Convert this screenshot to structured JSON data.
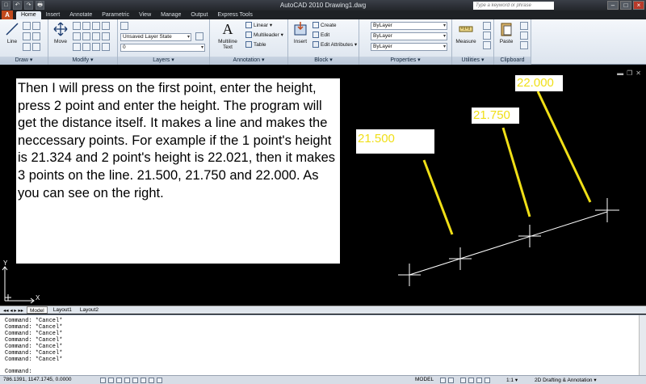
{
  "titlebar": {
    "title": "AutoCAD 2010     Drawing1.dwg",
    "search_placeholder": "Type a keyword or phrase",
    "qat": [
      "□",
      "↶",
      "↷",
      "🖶"
    ]
  },
  "tabs": [
    "Home",
    "Insert",
    "Annotate",
    "Parametric",
    "View",
    "Manage",
    "Output",
    "Express Tools"
  ],
  "ribbon": {
    "draw": {
      "title": "Draw ▾",
      "line_label": "Line"
    },
    "modify": {
      "title": "Modify ▾",
      "move_label": "Move"
    },
    "layers": {
      "title": "Layers ▾",
      "layer_state": "Unsaved Layer State",
      "current_layer": "0"
    },
    "annotation": {
      "title": "Annotation ▾",
      "multiline_text": "Multiline\nText",
      "linear": "Linear ▾",
      "multileader": "Multileader ▾",
      "table": "Table"
    },
    "block": {
      "title": "Block ▾",
      "insert": "Insert",
      "create": "Create",
      "edit": "Edit",
      "edit_attributes": "Edit Attributes ▾"
    },
    "properties": {
      "title": "Properties ▾",
      "color": "ByLayer",
      "linetype": "ByLayer",
      "lineweight": "ByLayer"
    },
    "utilities": {
      "title": "Utilities ▾",
      "measure": "Measure"
    },
    "clipboard": {
      "title": "Clipboard",
      "paste": "Paste"
    }
  },
  "note": "Then I will press on the first point, enter the height, press 2 point and enter the height. The program will get the distance itself. It makes a line and makes the neccessary points. For example if the 1 point's height is 21.324 and 2 point's height is 22.021, then it makes 3 points on the line.  21.500, 21.750 and 22.000. As you can see on the right.",
  "labels": [
    "21.500",
    "21.750",
    "22.000"
  ],
  "ucs": {
    "y": "Y",
    "x": "X"
  },
  "layout_tabs": [
    "Model",
    "Layout1",
    "Layout2"
  ],
  "command": {
    "history": [
      "Command: *Cancel*",
      "Command: *Cancel*",
      "Command: *Cancel*",
      "Command: *Cancel*",
      "Command: *Cancel*",
      "Command: *Cancel*",
      "Command: *Cancel*"
    ],
    "prompt": "Command:"
  },
  "status": {
    "coords": "786.1391, 1147.1745, 0.0000",
    "model": "MODEL",
    "annoscale": "1:1 ▾",
    "workspace": "2D Drafting & Annotation ▾"
  },
  "colors": {
    "label_yellow": "#f0df17",
    "drawing_bg": "#000000"
  }
}
